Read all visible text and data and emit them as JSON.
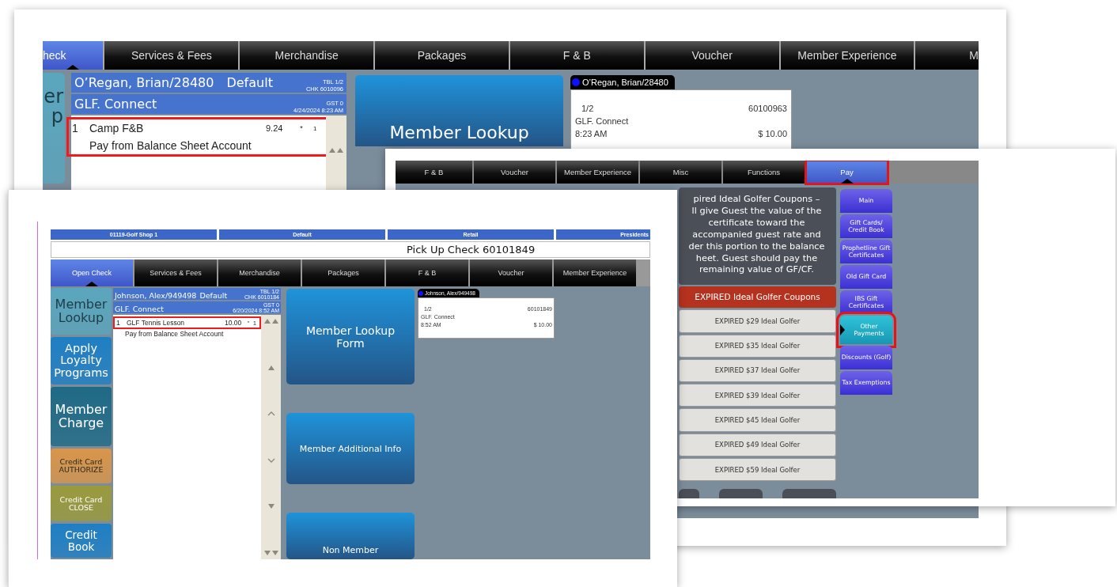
{
  "back_screenshot": {
    "tabs": [
      {
        "label": "heck",
        "selected": true,
        "highlighted": false
      },
      {
        "label": "Services & Fees",
        "selected": false,
        "highlighted": false
      },
      {
        "label": "Merchandise",
        "selected": false,
        "highlighted": false
      },
      {
        "label": "Packages",
        "selected": false,
        "highlighted": false
      },
      {
        "label": "F & B",
        "selected": false,
        "highlighted": false
      },
      {
        "label": "Voucher",
        "selected": false,
        "highlighted": false
      },
      {
        "label": "Member Experience",
        "selected": false,
        "highlighted": false
      },
      {
        "label": "M",
        "selected": false,
        "highlighted": false
      }
    ],
    "left_buttons": [
      {
        "label": "er\np",
        "color": "#5aa6bd"
      }
    ],
    "check": {
      "guest": "O’Regan, Brian/28480",
      "profile": "Default",
      "table": "TBL 1/2",
      "check_no": "CHK 6010096",
      "outlet": "GLF. Connect",
      "guests": "GST 0",
      "opened": "4/24/2024 8:23 AM",
      "lines": [
        {
          "kind": "item",
          "qty": "1",
          "name": "Camp F&B",
          "price": "9.24",
          "flag": "*",
          "seat": "1",
          "highlighted": true
        },
        {
          "kind": "modifier",
          "name": "Pay from Balance Sheet Account",
          "highlighted": true
        }
      ]
    },
    "big_buttons": [
      "Member Lookup"
    ],
    "check_card": {
      "guest": "O’Regan, Brian/28480",
      "table": "1/2",
      "check_no": "60100963",
      "outlet": "GLF. Connect",
      "time": "8:23 AM",
      "total": "$ 10.00"
    }
  },
  "pay_screenshot": {
    "tabs": [
      {
        "label": "F & B",
        "selected": false,
        "highlighted": false
      },
      {
        "label": "Voucher",
        "selected": false,
        "highlighted": false
      },
      {
        "label": "Member Experience",
        "selected": false,
        "highlighted": false
      },
      {
        "label": "Misc",
        "selected": false,
        "highlighted": false
      },
      {
        "label": "Functions",
        "selected": false,
        "highlighted": false
      },
      {
        "label": "Pay",
        "selected": true,
        "highlighted": true
      }
    ],
    "message_lines": [
      "pired Ideal Golfer Coupons –",
      "ll give Guest the value of the",
      "certificate toward the",
      "accompanied guest rate and",
      "der this portion to the balance",
      "heet.   Guest should pay the",
      "remaining value of GF/CF."
    ],
    "group_header": "EXPIRED Ideal Golfer Coupons",
    "items": [
      "EXPIRED $29 Ideal Golfer",
      "EXPIRED $35 Ideal Golfer",
      "EXPIRED $37 Ideal Golfer",
      "EXPIRED $39 Ideal Golfer",
      "EXPIRED $45 Ideal Golfer",
      "EXPIRED $49 Ideal Golfer",
      "EXPIRED $59 Ideal Golfer"
    ],
    "side_menu": [
      {
        "label": "Main",
        "selected": false,
        "highlighted": false
      },
      {
        "label": "Gift Cards/ Credit Book",
        "selected": false,
        "highlighted": false
      },
      {
        "label": "Prophetline Gift Certificates",
        "selected": false,
        "highlighted": false
      },
      {
        "label": "Old Gift Card",
        "selected": false,
        "highlighted": false
      },
      {
        "label": "IBS Gift Certificates",
        "selected": false,
        "highlighted": false
      },
      {
        "label": "Other Payments",
        "selected": true,
        "highlighted": true
      },
      {
        "label": "Discounts (Golf)",
        "selected": false,
        "highlighted": false
      },
      {
        "label": "Tax Exemptions",
        "selected": false,
        "highlighted": false
      }
    ]
  },
  "front_screenshot": {
    "info_bar": [
      "01119-Golf Shop 1",
      "Default",
      "Retail",
      "Presidents"
    ],
    "title": "Pick Up Check 60101849",
    "tabs": [
      {
        "label": "Open Check",
        "selected": true,
        "highlighted": false
      },
      {
        "label": "Services & Fees",
        "selected": false,
        "highlighted": false
      },
      {
        "label": "Merchandise",
        "selected": false,
        "highlighted": false
      },
      {
        "label": "Packages",
        "selected": false,
        "highlighted": false
      },
      {
        "label": "F & B",
        "selected": false,
        "highlighted": false
      },
      {
        "label": "Voucher",
        "selected": false,
        "highlighted": false
      },
      {
        "label": "Member Experience",
        "selected": false,
        "highlighted": false
      }
    ],
    "left_buttons": [
      {
        "label": "Member Lookup",
        "color": "#5aa6bd"
      },
      {
        "label": "Apply Loyalty Programs",
        "color": "#1f7fc4"
      },
      {
        "label": "Member Charge",
        "color": "#1f6a86"
      },
      {
        "label": "Credit Card AUTHORIZE",
        "color": "#d9954a"
      },
      {
        "label": "Credit Card CLOSE",
        "color": "#9a9a3c"
      },
      {
        "label": "Credit Book",
        "color": "#1f7fc4"
      }
    ],
    "check": {
      "guest": "Johnson, Alex/949498",
      "profile": "Default",
      "table": "TBL 1/2",
      "check_no": "CHK 6010184",
      "outlet": "GLF. Connect",
      "guests": "GST 0",
      "opened": "6/20/2024 8:52 AM",
      "lines": [
        {
          "kind": "item",
          "qty": "1",
          "name": "GLF Tennis Lesson",
          "price": "10.00",
          "flag": "*",
          "seat": "1",
          "highlighted": true
        },
        {
          "kind": "modifier",
          "name": "Pay from Balance Sheet Account",
          "highlighted": false
        }
      ]
    },
    "big_buttons": [
      "Member Lookup Form",
      "Member Additional Info",
      "Non Member"
    ],
    "check_card": {
      "guest": "Johnson, Alex/949498",
      "table": "1/2",
      "check_no": "60101849",
      "outlet": "GLF. Connect",
      "time": "8:52 AM",
      "total": "$  10.00"
    }
  }
}
